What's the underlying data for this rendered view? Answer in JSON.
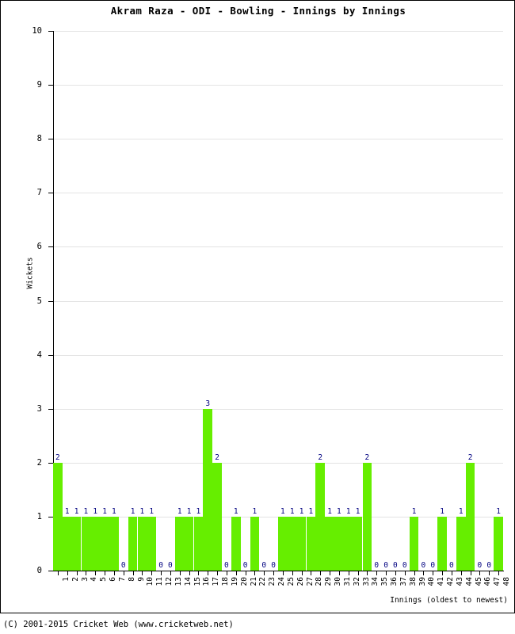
{
  "chart_data": {
    "type": "bar",
    "title": "Akram Raza - ODI - Bowling - Innings by Innings",
    "xlabel": "Innings (oldest to newest)",
    "ylabel": "Wickets",
    "ylim": [
      0,
      10
    ],
    "ytick_labels": [
      "0",
      "1",
      "2",
      "3",
      "4",
      "5",
      "6",
      "7",
      "8",
      "9",
      "10"
    ],
    "grid": true,
    "legend": null,
    "bar_color": "#66EE00",
    "label_color": "#000080",
    "categories": [
      "1",
      "2",
      "3",
      "4",
      "5",
      "6",
      "7",
      "8",
      "9",
      "10",
      "11",
      "12",
      "13",
      "14",
      "15",
      "16",
      "17",
      "18",
      "19",
      "20",
      "21",
      "22",
      "23",
      "24",
      "25",
      "26",
      "27",
      "28",
      "29",
      "30",
      "31",
      "32",
      "33",
      "34",
      "35",
      "36",
      "37",
      "38",
      "39",
      "40",
      "41",
      "42",
      "43",
      "44",
      "45",
      "46",
      "47",
      "48"
    ],
    "values": [
      2,
      1,
      1,
      1,
      1,
      1,
      1,
      0,
      1,
      1,
      1,
      0,
      0,
      1,
      1,
      1,
      3,
      2,
      0,
      1,
      0,
      1,
      0,
      0,
      1,
      1,
      1,
      1,
      2,
      1,
      1,
      1,
      1,
      2,
      0,
      0,
      0,
      0,
      1,
      0,
      0,
      1,
      0,
      1,
      2,
      0,
      0,
      1
    ]
  },
  "footer": {
    "copyright": "(C) 2001-2015 Cricket Web (www.cricketweb.net)"
  }
}
